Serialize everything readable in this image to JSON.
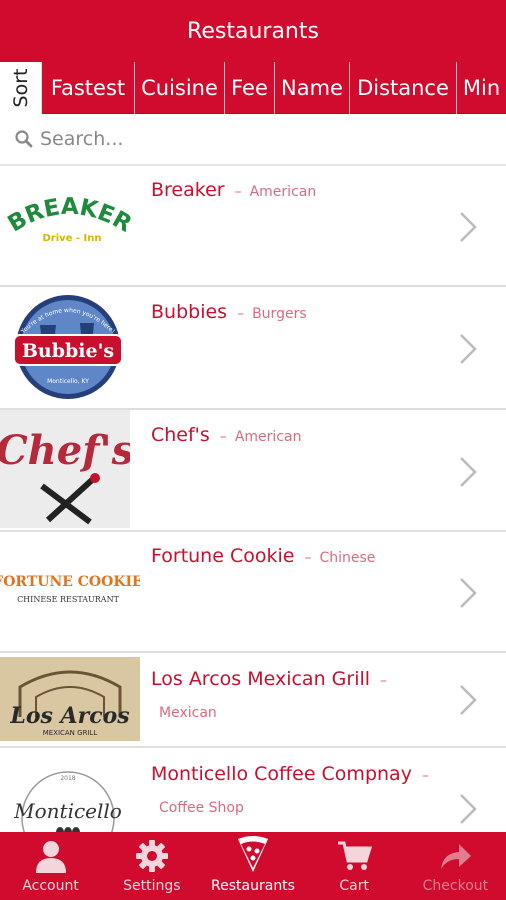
{
  "header": {
    "title": "Restaurants"
  },
  "sort_bar": {
    "label": "Sort",
    "options": [
      "Fastest",
      "Cuisine",
      "Fee",
      "Name",
      "Distance",
      "Min"
    ]
  },
  "search": {
    "placeholder": "Search..."
  },
  "restaurants": [
    {
      "name": "Breaker",
      "cuisine": "American",
      "logo_text": "BREAKER",
      "logo_sub": "Drive - Inn"
    },
    {
      "name": "Bubbies",
      "cuisine": "Burgers",
      "logo_text": "Bubbie's",
      "logo_sub": "Monticello, KY",
      "logo_arc": "\"You're at home when you're here!\""
    },
    {
      "name": "Chef's",
      "cuisine": "American",
      "logo_text": "Chef's"
    },
    {
      "name": "Fortune Cookie",
      "cuisine": "Chinese",
      "logo_text": "FORTUNE COOKIE",
      "logo_sub": "CHINESE    RESTAURANT"
    },
    {
      "name": "Los Arcos Mexican Grill",
      "cuisine": "Mexican",
      "logo_text": "Los Arcos",
      "logo_sub": "MEXICAN GRILL"
    },
    {
      "name": "Monticello Coffee Compnay",
      "cuisine": "Coffee Shop",
      "logo_text": "Monticello",
      "logo_sub": "2018"
    }
  ],
  "tabs": [
    {
      "label": "Account",
      "icon": "person-icon"
    },
    {
      "label": "Settings",
      "icon": "gear-icon"
    },
    {
      "label": "Restaurants",
      "icon": "pizza-slice-icon"
    },
    {
      "label": "Cart",
      "icon": "cart-icon"
    },
    {
      "label": "Checkout",
      "icon": "share-arrow-icon"
    }
  ],
  "colors": {
    "brand_red": "#d10b2e",
    "name_red": "#c8102e",
    "cuisine_pink": "#d96b7f"
  }
}
